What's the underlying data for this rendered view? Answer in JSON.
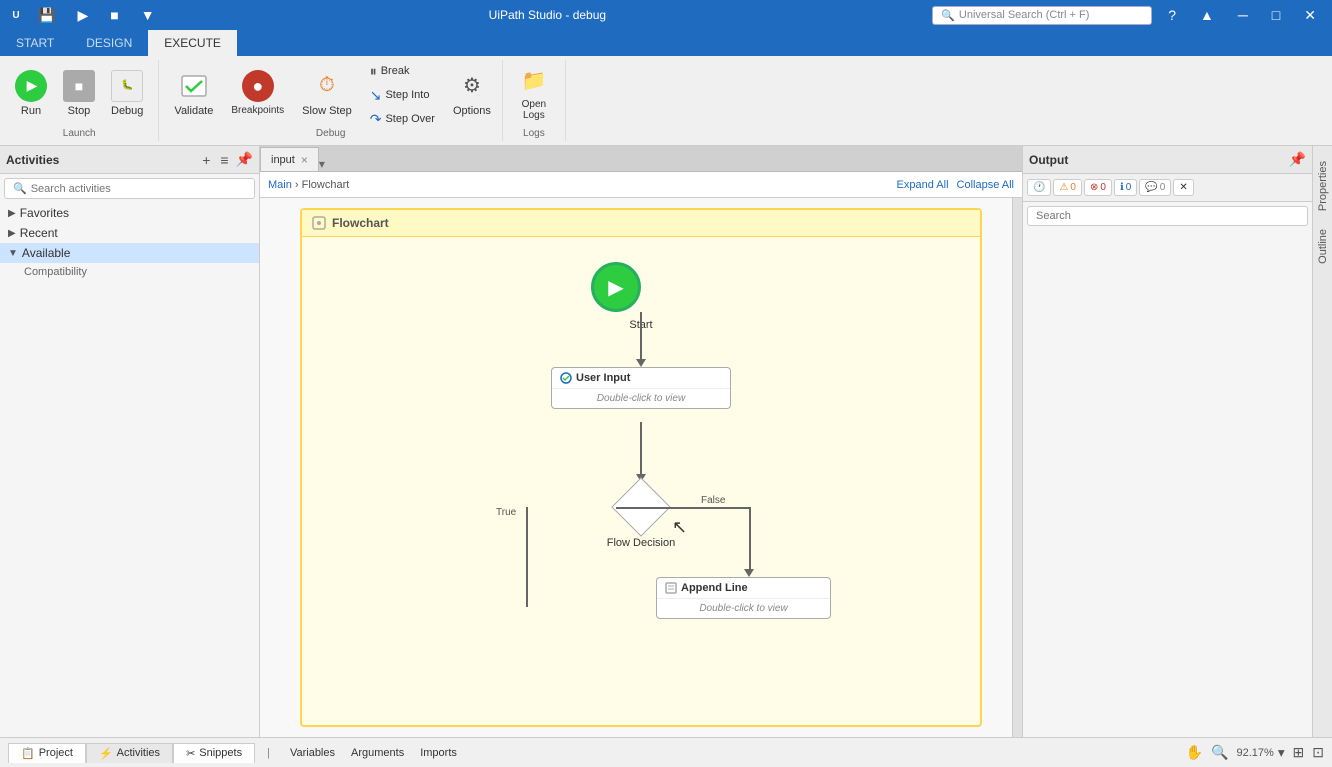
{
  "window": {
    "title": "UiPath Studio - debug",
    "min_label": "─",
    "max_label": "□",
    "close_label": "✕"
  },
  "titlebar": {
    "save_icon": "💾",
    "run_icon": "▶",
    "stop_icon": "■",
    "dropdown_icon": "▼"
  },
  "tabs": {
    "start": "START",
    "design": "DESIGN",
    "execute": "EXECUTE"
  },
  "ribbon": {
    "run_label": "Run",
    "stop_label": "Stop",
    "debug_label": "Debug",
    "validate_label": "Validate",
    "breakpoints_label": "Breakpoints",
    "slowstep_label": "Slow Step",
    "options_label": "Options",
    "openlogs_label": "Open\nLogs",
    "break_label": "Break",
    "stepinto_label": "Step Into",
    "stepover_label": "Step Over",
    "launch_group": "Launch",
    "debug_group": "Debug",
    "logs_group": "Logs"
  },
  "search": {
    "placeholder": "Universal Search (Ctrl + F)",
    "icon": "🔍"
  },
  "activities_panel": {
    "title": "Activities",
    "search_placeholder": "Search activities",
    "collapse_icon": "≡",
    "pin_icon": "📌",
    "add_icon": "+",
    "items": [
      {
        "label": "Favorites",
        "expanded": false
      },
      {
        "label": "Recent",
        "expanded": false
      },
      {
        "label": "Available",
        "expanded": true
      },
      {
        "label": "Compatibility",
        "indent": true
      }
    ]
  },
  "editor": {
    "tab_label": "input",
    "tab_close": "×",
    "breadcrumb_main": "Main",
    "breadcrumb_sep": "›",
    "breadcrumb_flowchart": "Flowchart",
    "expand_all": "Expand All",
    "collapse_all": "Collapse All",
    "flowchart_title": "Flowchart",
    "nodes": {
      "start_label": "Start",
      "user_input_label": "User Input",
      "user_input_hint": "Double-click to view",
      "flow_decision_label": "Flow Decision",
      "append_line_label": "Append Line",
      "append_line_hint": "Double-click to view",
      "true_label": "True",
      "false_label": "False"
    }
  },
  "output_panel": {
    "title": "Output",
    "search_placeholder": "Search",
    "pin_icon": "📌",
    "clock_icon": "🕐",
    "warn_count": "0",
    "err_count": "0",
    "info_count": "0",
    "msg_count": "0",
    "close_icon": "✕"
  },
  "side_tabs": {
    "properties": "Properties",
    "outline": "Outline"
  },
  "bottom_bar": {
    "project_label": "Project",
    "activities_label": "Activities",
    "snippets_label": "Snippets",
    "zoom_level": "92.17%",
    "zoom_dropdown": "▾"
  },
  "status_bar": {
    "variables_label": "Variables",
    "arguments_label": "Arguments",
    "imports_label": "Imports"
  }
}
